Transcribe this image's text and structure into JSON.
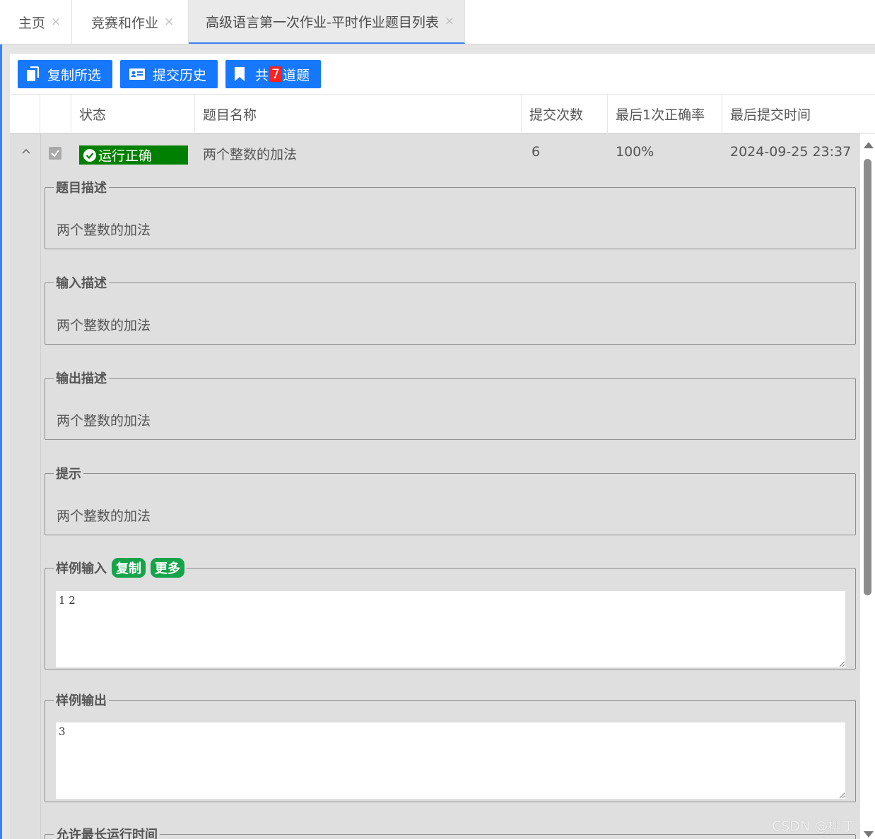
{
  "tabs": [
    {
      "label": "主页",
      "close": "×"
    },
    {
      "label": "竞赛和作业",
      "close": "×"
    },
    {
      "label": "高级语言第一次作业-平时作业题目列表",
      "close": "×"
    }
  ],
  "toolbar": {
    "copy_selected": "复制所选",
    "submit_history": "提交历史",
    "total_prefix": "共",
    "total_count": "7",
    "total_suffix": "道题"
  },
  "table": {
    "columns": [
      "状态",
      "题目名称",
      "提交次数",
      "最后1次正确率",
      "最后提交时间"
    ],
    "row": {
      "status": "运行正确",
      "name": "两个整数的加法",
      "submit_count": "6",
      "last_accuracy": "100%",
      "last_submit_time": "2024-09-25 23:37",
      "checked": true
    }
  },
  "detail": {
    "problem_desc_title": "题目描述",
    "problem_desc": "两个整数的加法",
    "input_desc_title": "输入描述",
    "input_desc": "两个整数的加法",
    "output_desc_title": "输出描述",
    "output_desc": "两个整数的加法",
    "hint_title": "提示",
    "hint": "两个整数的加法",
    "sample_input_title": "样例输入",
    "copy_tag": "复制",
    "more_tag": "更多",
    "sample_input": "1 2",
    "sample_output_title": "样例输出",
    "sample_output": "3",
    "time_limit_title": "允许最长运行时间"
  },
  "watermark": "CSDN @柳丁.",
  "colors": {
    "accent": "#1677ff",
    "status_ok": "#008000",
    "tag": "#16a34a",
    "count_badge": "#ff2020"
  }
}
